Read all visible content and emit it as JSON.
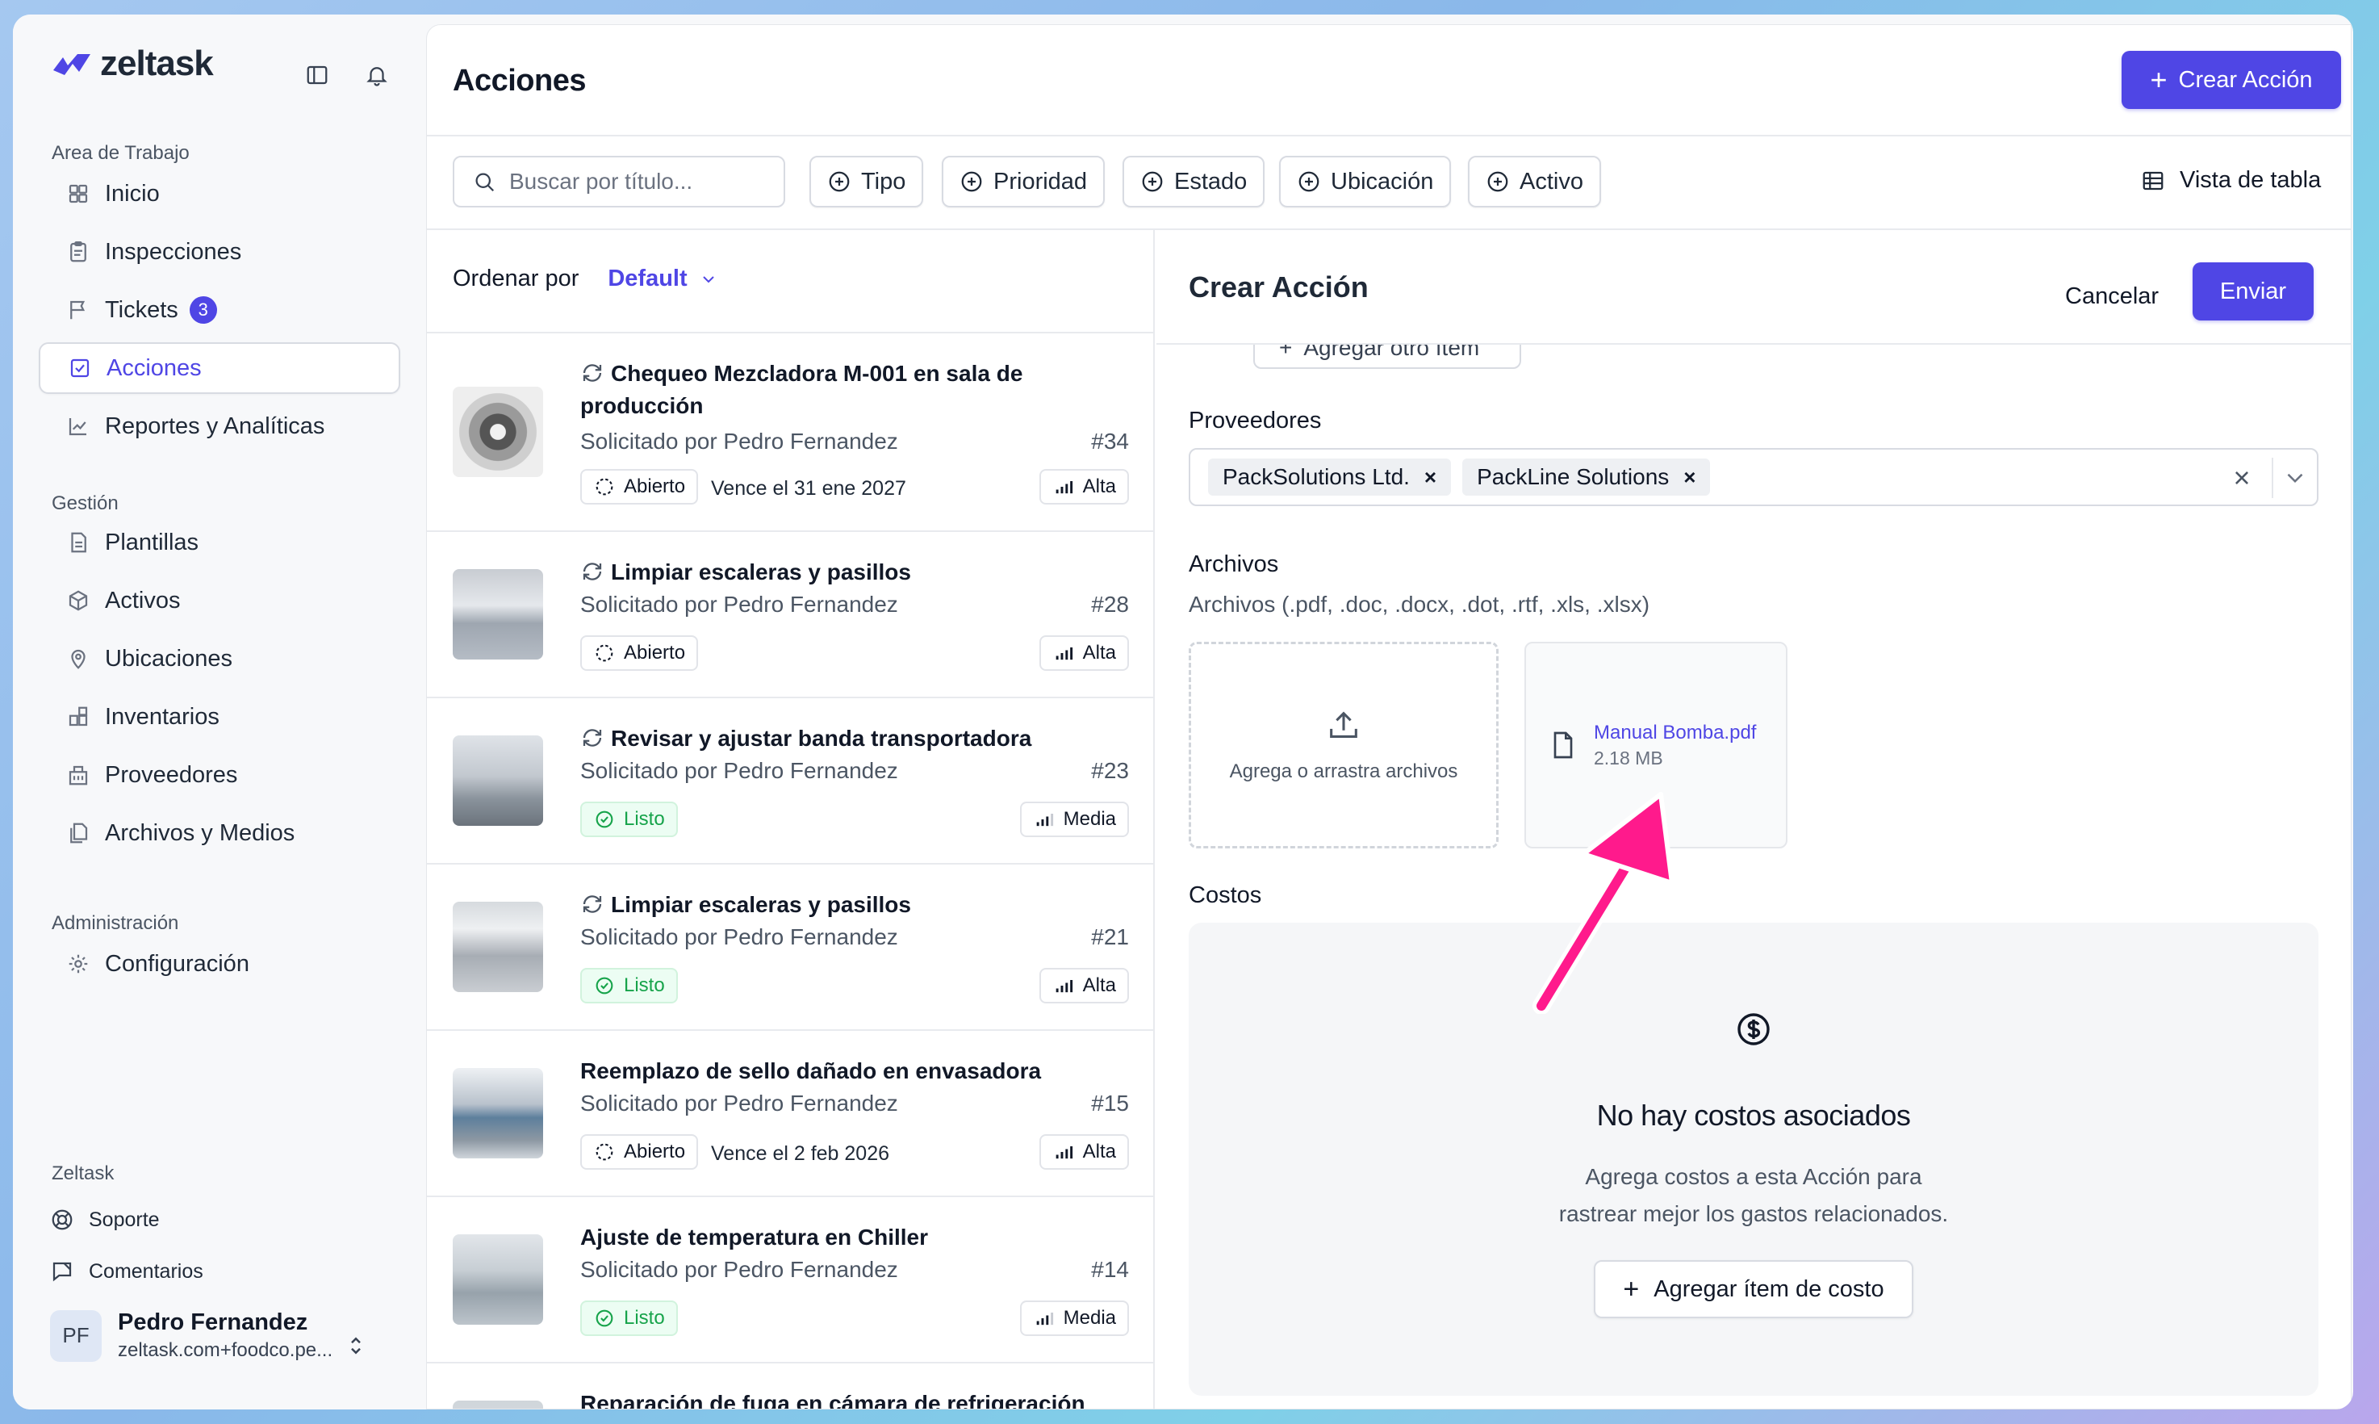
{
  "brand": {
    "name": "zeltask"
  },
  "sidebar": {
    "workspace_label": "Area de Trabajo",
    "workspace_items": [
      {
        "label": "Inicio",
        "icon": "grid-icon"
      },
      {
        "label": "Inspecciones",
        "icon": "clipboard-icon"
      },
      {
        "label": "Tickets",
        "icon": "flag-icon",
        "badge": "3"
      },
      {
        "label": "Acciones",
        "icon": "check-square-icon",
        "active": true
      },
      {
        "label": "Reportes y Analíticas",
        "icon": "chart-icon"
      }
    ],
    "management_label": "Gestión",
    "management_items": [
      {
        "label": "Plantillas",
        "icon": "file-icon"
      },
      {
        "label": "Activos",
        "icon": "cube-icon"
      },
      {
        "label": "Ubicaciones",
        "icon": "pin-icon"
      },
      {
        "label": "Inventarios",
        "icon": "boxes-icon"
      },
      {
        "label": "Proveedores",
        "icon": "building-icon"
      },
      {
        "label": "Archivos y Medios",
        "icon": "files-icon"
      }
    ],
    "admin_label": "Administración",
    "admin_items": [
      {
        "label": "Configuración",
        "icon": "gear-icon"
      }
    ],
    "footer_label": "Zeltask",
    "footer_items": [
      {
        "label": "Soporte",
        "icon": "lifebuoy-icon"
      },
      {
        "label": "Comentarios",
        "icon": "message-icon"
      }
    ],
    "user": {
      "initials": "PF",
      "name": "Pedro Fernandez",
      "email": "zeltask.com+foodco.pe..."
    }
  },
  "header": {
    "title": "Acciones",
    "create_button": "Crear Acción"
  },
  "filters": {
    "search_placeholder": "Buscar por título...",
    "chips": [
      "Tipo",
      "Prioridad",
      "Estado",
      "Ubicación",
      "Activo"
    ],
    "view_toggle": "Vista de tabla"
  },
  "list": {
    "sort_label": "Ordenar por",
    "sort_value": "Default",
    "items": [
      {
        "title": "Chequeo Mezcladora M-001 en sala de producción",
        "recurring": true,
        "requested_by": "Solicitado por Pedro Fernandez",
        "number": "#34",
        "status": "Abierto",
        "due": "Vence el 31 ene 2027",
        "priority": "Alta"
      },
      {
        "title": "Limpiar escaleras y pasillos",
        "recurring": true,
        "requested_by": "Solicitado por Pedro Fernandez",
        "number": "#28",
        "status": "Abierto",
        "due": "",
        "priority": "Alta"
      },
      {
        "title": "Revisar y ajustar banda transportadora",
        "recurring": true,
        "requested_by": "Solicitado por Pedro Fernandez",
        "number": "#23",
        "status": "Listo",
        "due": "",
        "priority": "Media"
      },
      {
        "title": "Limpiar escaleras y pasillos",
        "recurring": true,
        "requested_by": "Solicitado por Pedro Fernandez",
        "number": "#21",
        "status": "Listo",
        "due": "",
        "priority": "Alta"
      },
      {
        "title": "Reemplazo de sello dañado en envasadora",
        "recurring": false,
        "requested_by": "Solicitado por Pedro Fernandez",
        "number": "#15",
        "status": "Abierto",
        "due": "Vence el 2 feb 2026",
        "priority": "Alta"
      },
      {
        "title": "Ajuste de temperatura en Chiller",
        "recurring": false,
        "requested_by": "Solicitado por Pedro Fernandez",
        "number": "#14",
        "status": "Listo",
        "due": "",
        "priority": "Media"
      },
      {
        "title": "Reparación de fuga en cámara de refrigeración",
        "recurring": false
      }
    ]
  },
  "form": {
    "title": "Crear Acción",
    "cancel": "Cancelar",
    "submit": "Enviar",
    "add_item_button": "Agregar otro ítem",
    "suppliers_label": "Proveedores",
    "suppliers": [
      "PackSolutions Ltd.",
      "PackLine Solutions"
    ],
    "files_label": "Archivos",
    "files_hint": "Archivos (.pdf, .doc, .docx, .dot, .rtf, .xls, .xlsx)",
    "dropzone_text": "Agrega o arrastra archivos",
    "file": {
      "name": "Manual Bomba.pdf",
      "size": "2.18 MB"
    },
    "costs_label": "Costos",
    "costs_empty_title": "No hay costos asociados",
    "costs_empty_desc_1": "Agrega costos a esta Acción para",
    "costs_empty_desc_2": "rastrear mejor los gastos relacionados.",
    "add_cost_button": "Agregar ítem de costo"
  },
  "colors": {
    "accent": "#4f46e5",
    "success": "#16a34a",
    "annotation_arrow": "#ff1a8c"
  }
}
